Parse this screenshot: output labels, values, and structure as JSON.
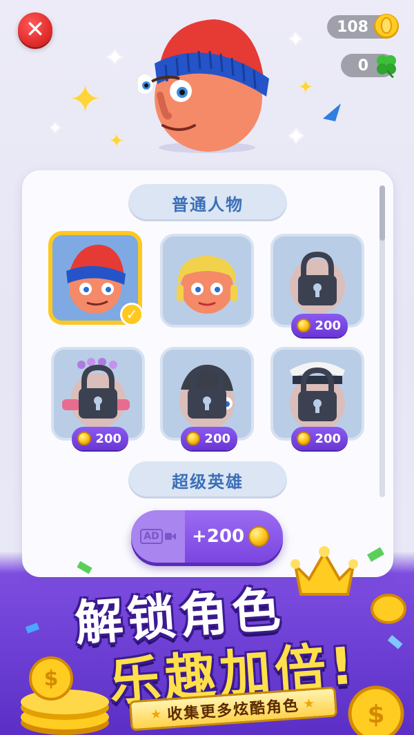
{
  "header": {
    "close_symbol": "✕",
    "coins": "108",
    "clovers": "0",
    "coin_icon": "coin-icon",
    "clover_icon": "clover-icon"
  },
  "sections": [
    {
      "title": "普通人物"
    },
    {
      "title": "超级英雄"
    }
  ],
  "characters": [
    {
      "name": "beanie-boy",
      "state": "selected"
    },
    {
      "name": "blonde-girl",
      "state": "owned"
    },
    {
      "name": "bald-man",
      "state": "locked",
      "price": "200"
    },
    {
      "name": "flower-crown-girl",
      "state": "locked",
      "price": "200"
    },
    {
      "name": "black-beanie-man",
      "state": "locked",
      "price": "200"
    },
    {
      "name": "captain",
      "state": "locked",
      "price": "200"
    }
  ],
  "ad_button": {
    "tag": "AD",
    "amount": "+200"
  },
  "promo": {
    "line1": "解锁角色",
    "line2": "乐趣加倍!",
    "ribbon": "收集更多炫酷角色"
  },
  "colors": {
    "accent_purple": "#7a45e0",
    "gold": "#ffc81f",
    "section_text": "#3b6fb8",
    "close_red": "#e12a2a"
  }
}
